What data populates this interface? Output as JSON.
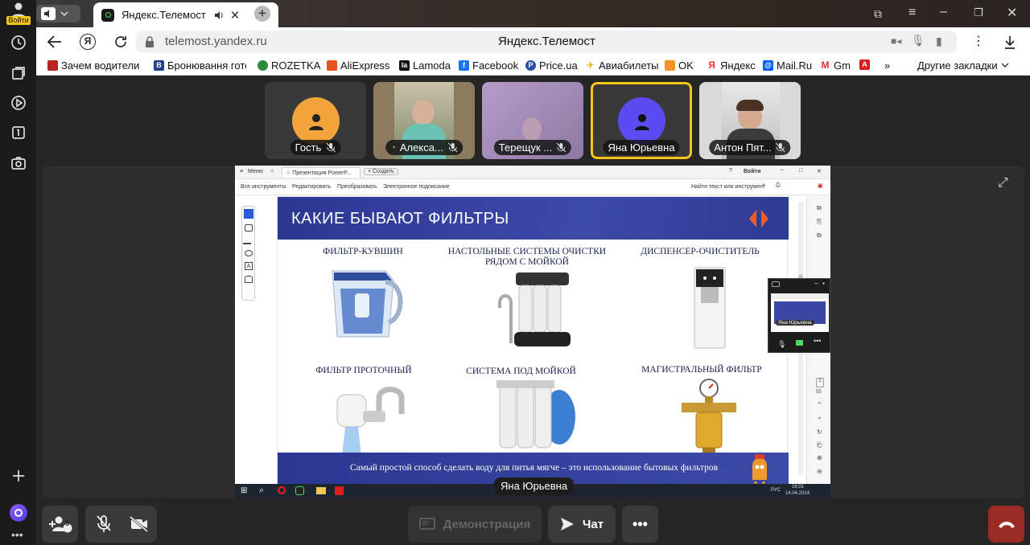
{
  "browser": {
    "login_badge": "Войти",
    "tab_title": "Яндекс.Телемост",
    "url": "telemost.yandex.ru",
    "page_title": "Яндекс.Телемост"
  },
  "bookmarks": [
    "Зачем водители в",
    "Бронювання готе",
    "ROZETKA",
    "AliExpress",
    "Lamoda",
    "Facebook",
    "Price.ua",
    "Авиабилеты",
    "OK",
    "Яндекс",
    "Mail.Ru",
    "Gm"
  ],
  "bookmarks_more": "»",
  "bookmarks_other": "Другие закладки",
  "participants": [
    {
      "name": "Гость",
      "color": "#f2a33a"
    },
    {
      "name": "Алекса..."
    },
    {
      "name": "Терещук ..."
    },
    {
      "name": "Яна Юрьевна",
      "color": "#5a4cf0",
      "active": true
    },
    {
      "name": "Антон Пят..."
    }
  ],
  "viewer": {
    "menu": "Меню",
    "tab": "Презентация PowerP...",
    "new_tab": "Создать",
    "login": "Войти",
    "tools": [
      "Все инструменты",
      "Редактировать",
      "Преобразовать",
      "Электронное подписание"
    ],
    "search": "Найти текст или инструмент",
    "zoom_value": "55"
  },
  "slide": {
    "title": "КАКИЕ БЫВАЮТ ФИЛЬТРЫ",
    "items": [
      "ФИЛЬТР-КУВШИН",
      "НАСТОЛЬНЫЕ СИСТЕМЫ ОЧИСТКИ РЯДОМ С МОЙКОЙ",
      "ДИСПЕНСЕР-ОЧИСТИТЕЛЬ",
      "ФИЛЬТР ПРОТОЧНЫЙ",
      "СИСТЕМА ПОД МОЙКОЙ",
      "МАГИСТРАЛЬНЫЙ ФИЛЬТР"
    ],
    "footer": "Самый простой способ сделать воду для питья мягче – это использование бытовых фильтров"
  },
  "taskbar": {
    "time": "16:01",
    "date": "14.04.2024",
    "lang": "РУС"
  },
  "mini_window": {
    "label": "Яна Юрьевна"
  },
  "presenter": "Яна Юрьевна",
  "controls": {
    "participants_count": "5",
    "demo": "Демонстрация",
    "chat": "Чат"
  },
  "colors": {
    "slide_blue": "#2c3a8f",
    "active_border": "#f5c518",
    "hangup": "#9b2a24"
  }
}
